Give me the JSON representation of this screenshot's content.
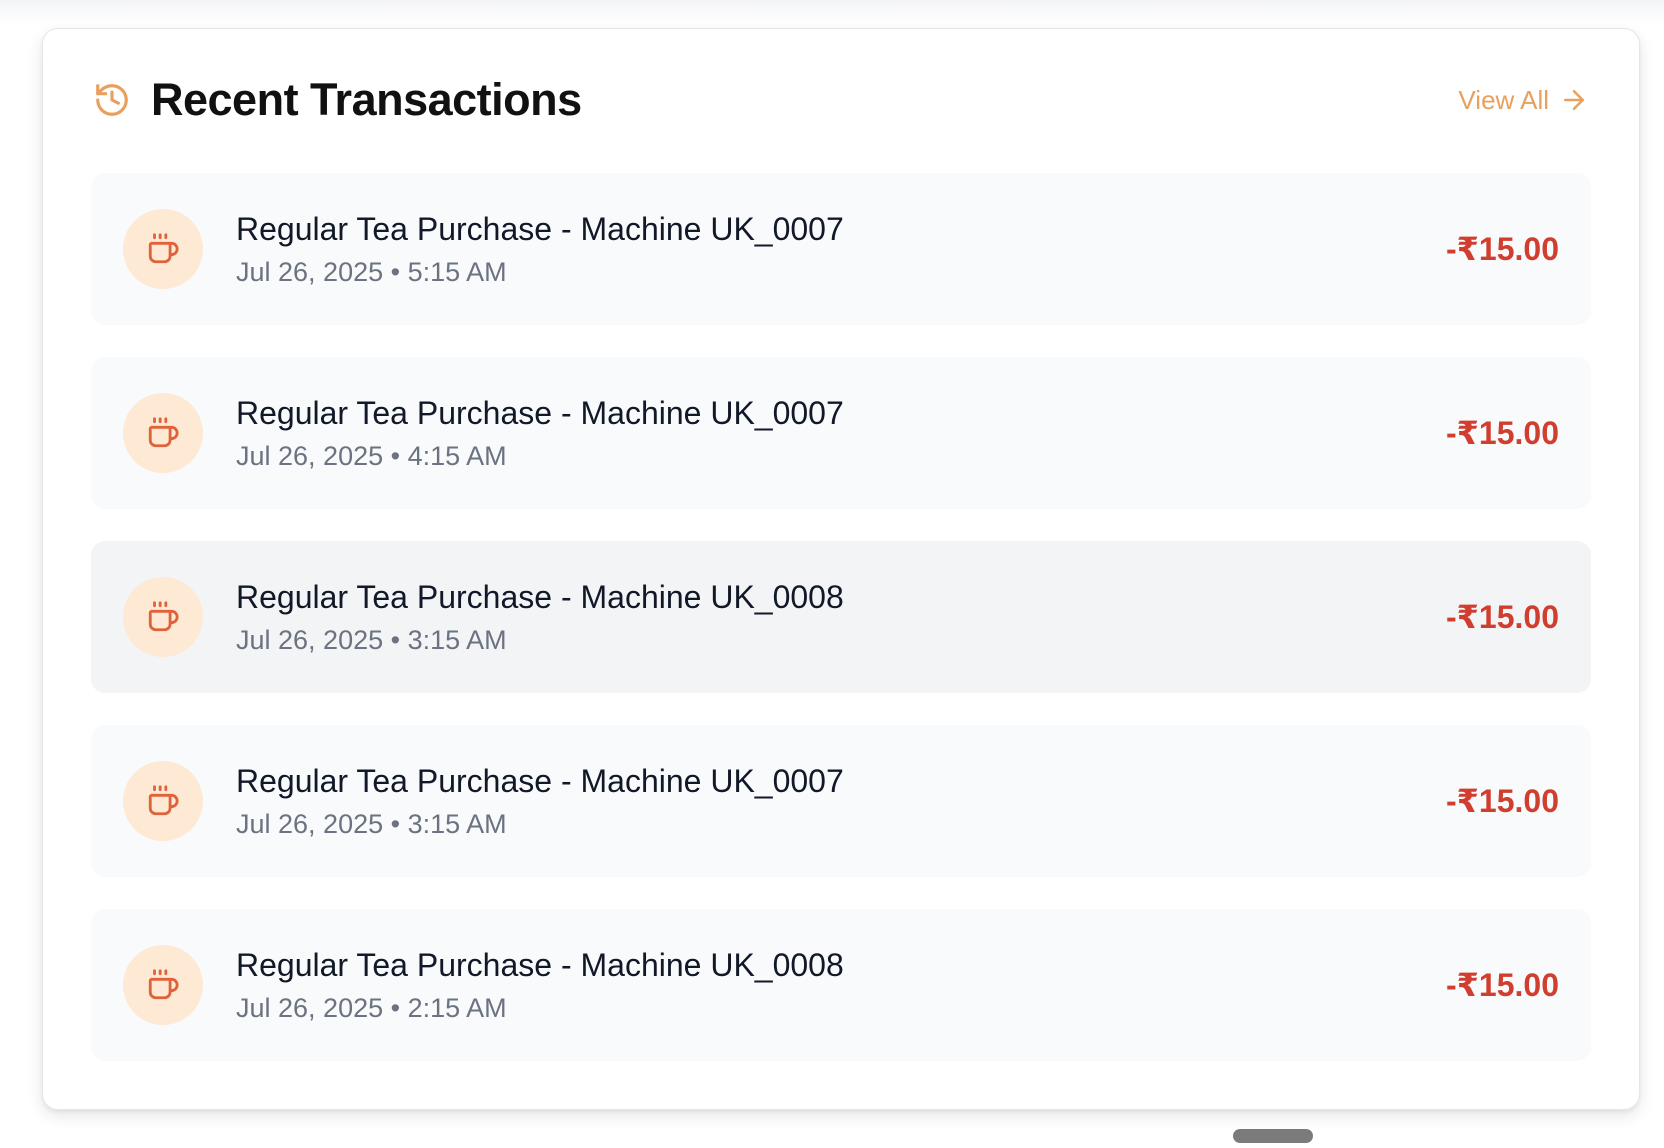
{
  "header": {
    "title": "Recent Transactions",
    "view_all_label": "View All",
    "icon": "history-icon",
    "accent_color": "#e9a05d"
  },
  "transactions": [
    {
      "title": "Regular Tea Purchase - Machine UK_0007",
      "date": "Jul 26, 2025",
      "time": "5:15 AM",
      "amount": "-₹15.00",
      "icon": "coffee-cup-icon"
    },
    {
      "title": "Regular Tea Purchase - Machine UK_0007",
      "date": "Jul 26, 2025",
      "time": "4:15 AM",
      "amount": "-₹15.00",
      "icon": "coffee-cup-icon"
    },
    {
      "title": "Regular Tea Purchase - Machine UK_0008",
      "date": "Jul 26, 2025",
      "time": "3:15 AM",
      "amount": "-₹15.00",
      "icon": "coffee-cup-icon"
    },
    {
      "title": "Regular Tea Purchase - Machine UK_0007",
      "date": "Jul 26, 2025",
      "time": "3:15 AM",
      "amount": "-₹15.00",
      "icon": "coffee-cup-icon"
    },
    {
      "title": "Regular Tea Purchase - Machine UK_0008",
      "date": "Jul 26, 2025",
      "time": "2:15 AM",
      "amount": "-₹15.00",
      "icon": "coffee-cup-icon"
    }
  ],
  "colors": {
    "amount_negative": "#cf3e2f",
    "icon_bg": "#fde9d4",
    "icon_stroke": "#e0623a"
  }
}
